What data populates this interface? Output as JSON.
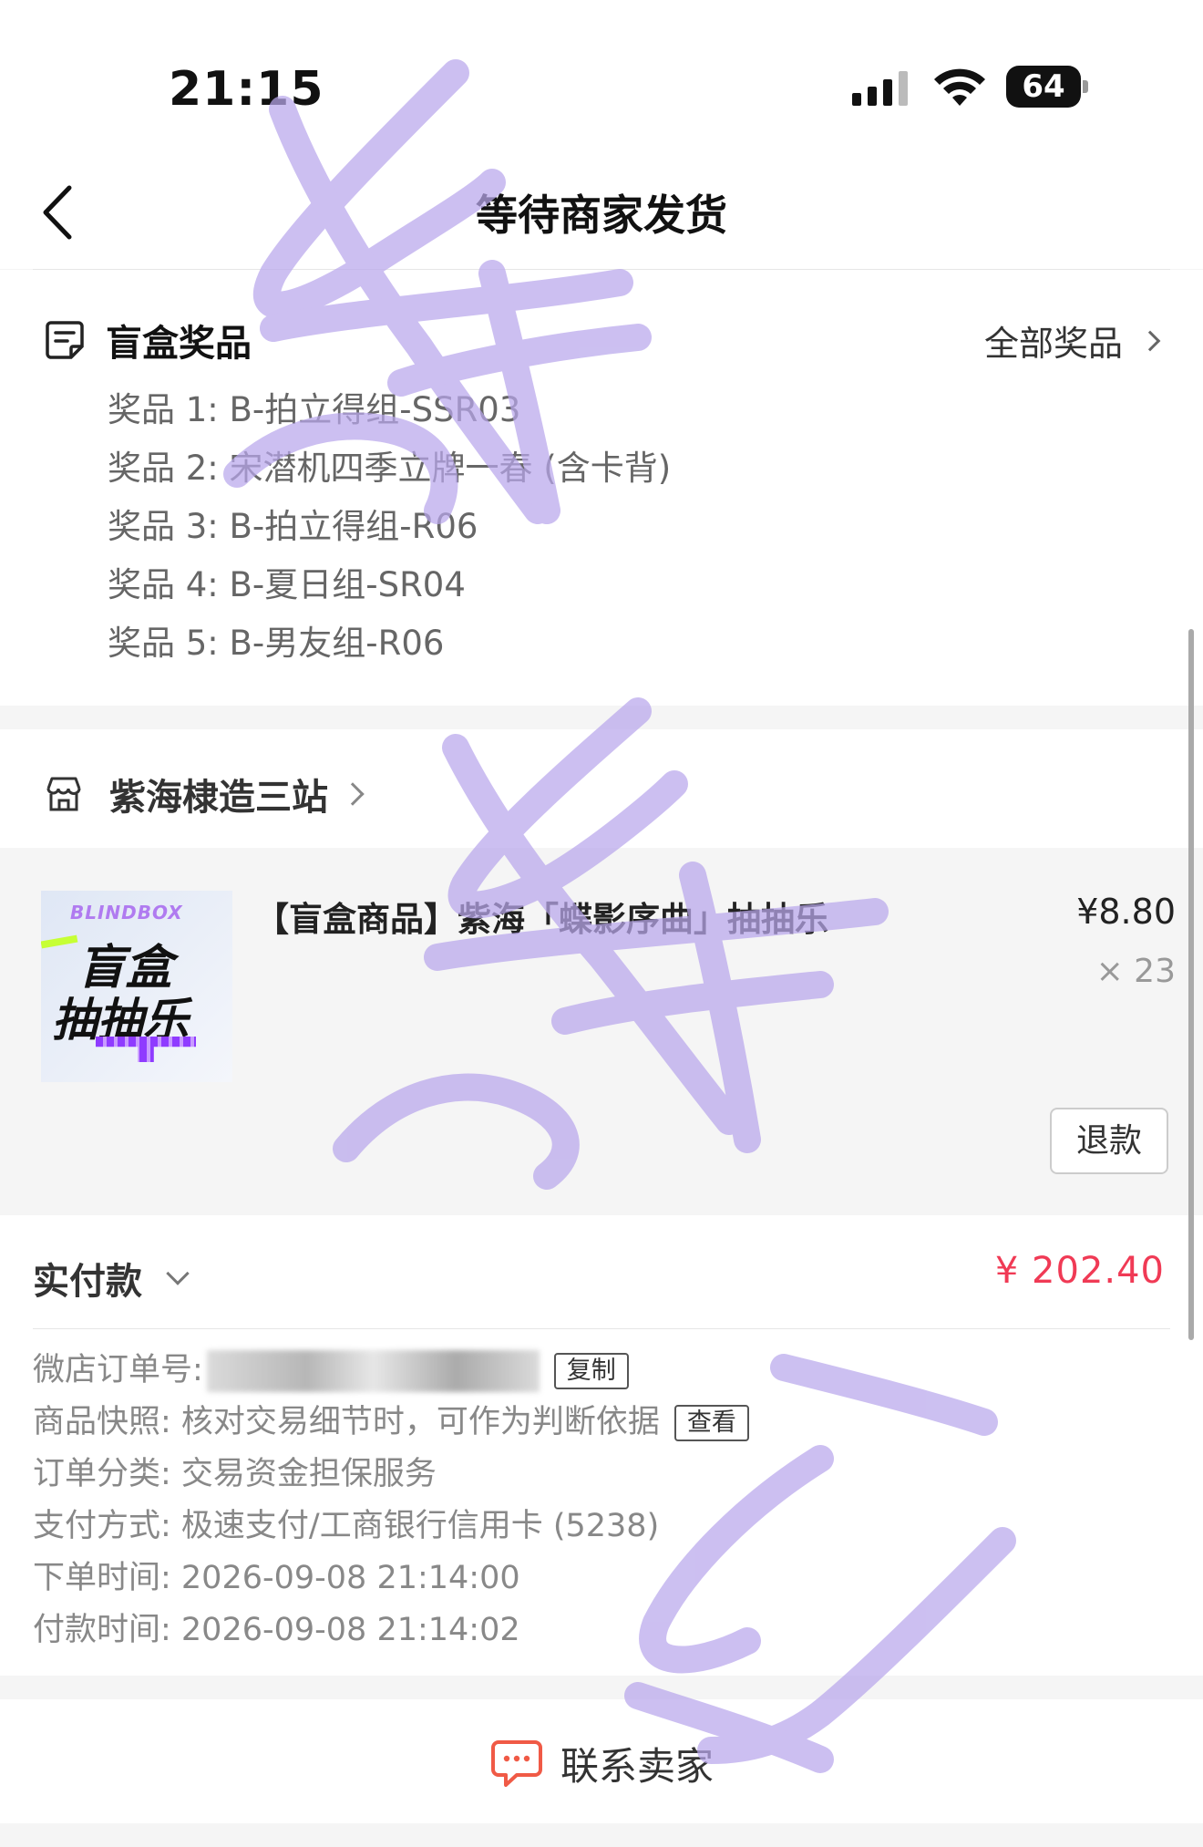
{
  "status_bar": {
    "time": "21:15",
    "battery": "64"
  },
  "nav": {
    "title": "等待商家发货"
  },
  "prizes": {
    "title": "盲盒奖品",
    "all_link": "全部奖品",
    "items": [
      "奖品 1: B-拍立得组-SSR03",
      "奖品 2: 宋潜机四季立牌一春 (含卡背)",
      "奖品 3: B-拍立得组-R06",
      "奖品 4: B-夏日组-SR04",
      "奖品 5: B-男友组-R06"
    ]
  },
  "shop": {
    "name": "紫海棣造三站"
  },
  "product": {
    "thumb_brand": "BLINDBOX",
    "thumb_line1": "盲盒",
    "thumb_line2": "抽抽乐",
    "title": "【盲盒商品】紫海「蝶影序曲」抽抽乐",
    "price": "¥8.80",
    "quantity": "× 23",
    "refund_label": "退款"
  },
  "payment": {
    "label": "实付款",
    "amount": "¥ 202.40",
    "info": {
      "order_no_label": "微店订单号:",
      "copy_label": "复制",
      "snapshot": "商品快照: 核对交易细节时，可作为判断依据",
      "view_label": "查看",
      "category": "订单分类:  交易资金担保服务",
      "pay_method": "支付方式:  极速支付/工商银行信用卡 (5238)",
      "order_time": "下单时间:  2026-09-08 21:14:00",
      "pay_time": "付款时间:  2026-09-08 21:14:02"
    }
  },
  "contact": {
    "label": "联系卖家"
  },
  "colors": {
    "accent_red": "#f03a55",
    "watermark": "#b9a7ec"
  }
}
